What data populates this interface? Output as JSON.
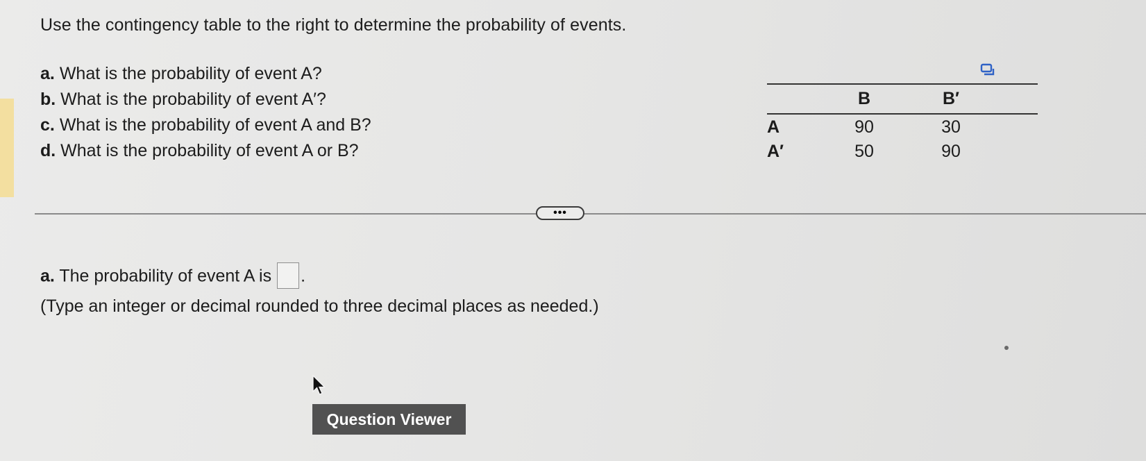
{
  "intro": "Use the contingency table to the right to determine the probability of events.",
  "questions": [
    {
      "letter": "a.",
      "text": "What is the probability of event A?"
    },
    {
      "letter": "b.",
      "text": "What is the probability of event A′?"
    },
    {
      "letter": "c.",
      "text": "What is the probability of event A and B?"
    },
    {
      "letter": "d.",
      "text": "What is the probability of event A or B?"
    }
  ],
  "table": {
    "columns": [
      "B",
      "B′"
    ],
    "rows": [
      {
        "label": "A",
        "values": [
          "90",
          "30"
        ]
      },
      {
        "label": "A′",
        "values": [
          "50",
          "90"
        ]
      }
    ]
  },
  "more_button": "•••",
  "answer": {
    "letter": "a.",
    "prefix": "The probability of event A is",
    "suffix": ".",
    "input_value": ""
  },
  "hint": "(Type an integer or decimal rounded to three decimal places as needed.)",
  "question_viewer_label": "Question Viewer",
  "icons": [
    "copy-icon",
    "mouse-pointer-icon"
  ]
}
